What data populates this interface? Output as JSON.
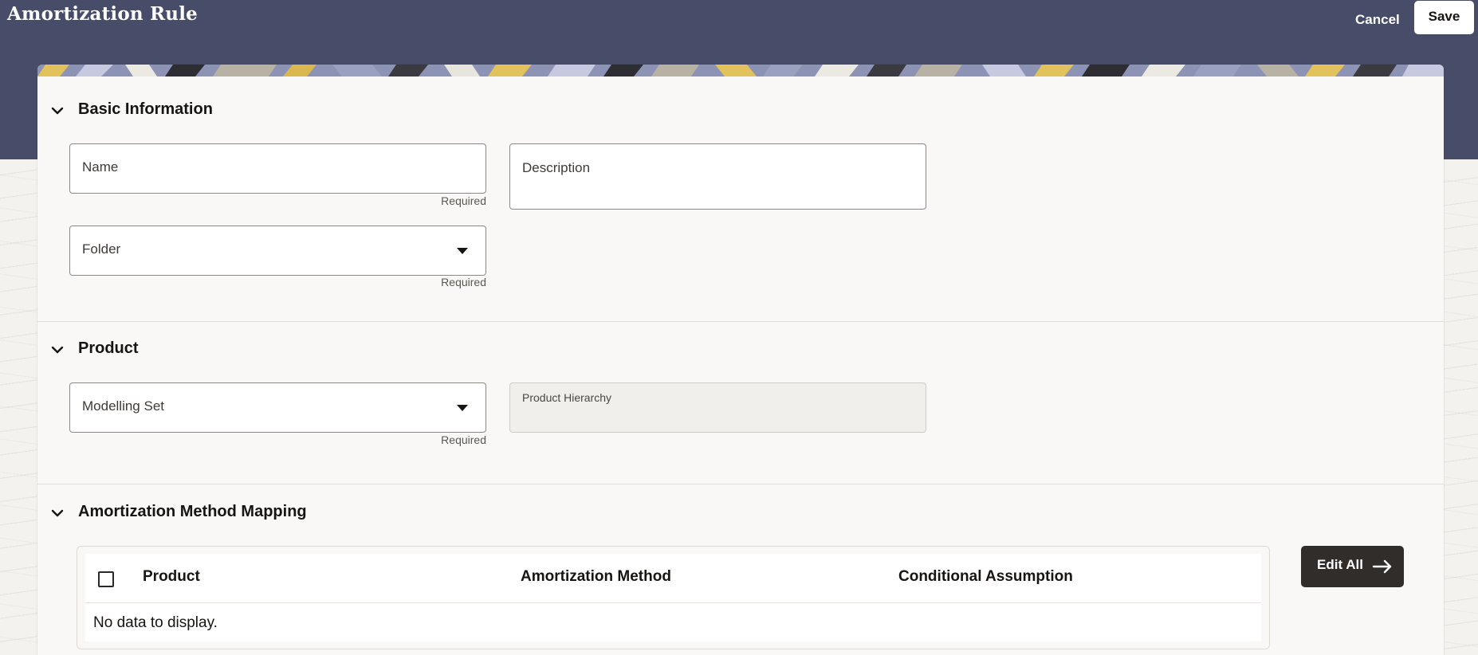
{
  "header": {
    "title": "Amortization Rule",
    "cancel_label": "Cancel",
    "save_label": "Save",
    "background_color": "#474d69"
  },
  "sections": {
    "basic": {
      "title": "Basic Information",
      "name_label": "Name",
      "name_helper": "Required",
      "description_label": "Description",
      "folder_label": "Folder",
      "folder_helper": "Required"
    },
    "product": {
      "title": "Product",
      "modelling_set_label": "Modelling Set",
      "modelling_set_helper": "Required",
      "product_hierarchy_label": "Product Hierarchy"
    },
    "mapping": {
      "title": "Amortization Method Mapping",
      "columns": [
        "Product",
        "Amortization Method",
        "Conditional Assumption"
      ],
      "empty_text": "No data to display.",
      "edit_all_label": "Edit All"
    }
  },
  "icons": {
    "section_toggle": "chevron-down-icon",
    "dropdown": "caret-down-icon",
    "edit_all": "arrow-right-icon"
  }
}
